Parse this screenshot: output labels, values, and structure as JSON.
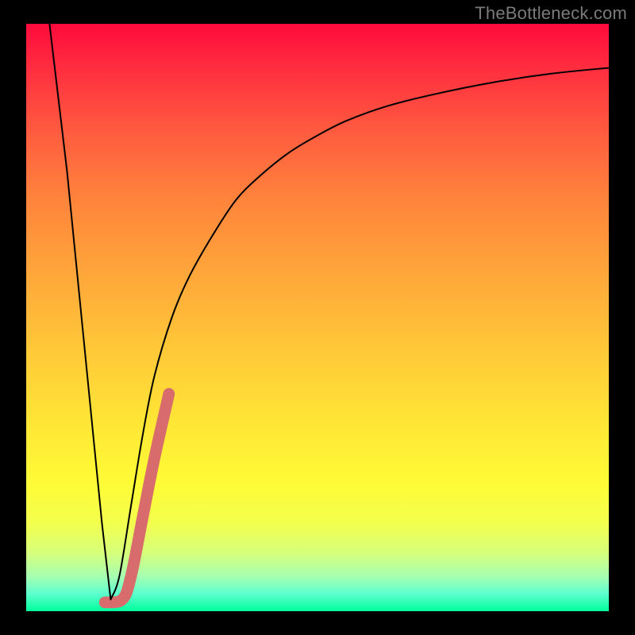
{
  "watermark": "TheBottleneck.com",
  "colors": {
    "background": "#000000",
    "curve": "#000000",
    "marker": "#d86b6b"
  },
  "chart_data": {
    "type": "line",
    "title": "",
    "xlabel": "",
    "ylabel": "",
    "xlim": [
      0,
      100
    ],
    "ylim": [
      0,
      100
    ],
    "grid": false,
    "legend": "none",
    "series": [
      {
        "name": "left-descent",
        "x": [
          4,
          7,
          9,
          11,
          13,
          14.5
        ],
        "y": [
          100,
          75,
          55,
          35,
          15,
          2
        ]
      },
      {
        "name": "right-curve",
        "x": [
          14.5,
          16,
          18,
          20,
          22,
          25,
          28,
          32,
          36,
          40,
          45,
          50,
          55,
          62,
          70,
          80,
          90,
          100
        ],
        "y": [
          2,
          6,
          18,
          30,
          40,
          50,
          57,
          64,
          70,
          74,
          78,
          81,
          83.5,
          86,
          88,
          90,
          91.5,
          92.5
        ]
      }
    ],
    "annotations": [
      {
        "name": "marker-stroke",
        "type": "polyline",
        "points": [
          [
            13.5,
            1.5
          ],
          [
            16.5,
            2.0
          ],
          [
            18.0,
            6.0
          ],
          [
            20.0,
            16.0
          ],
          [
            22.0,
            26.0
          ],
          [
            24.5,
            37.0
          ]
        ],
        "color": "#d86b6b",
        "width_pct": 2.0
      }
    ]
  }
}
